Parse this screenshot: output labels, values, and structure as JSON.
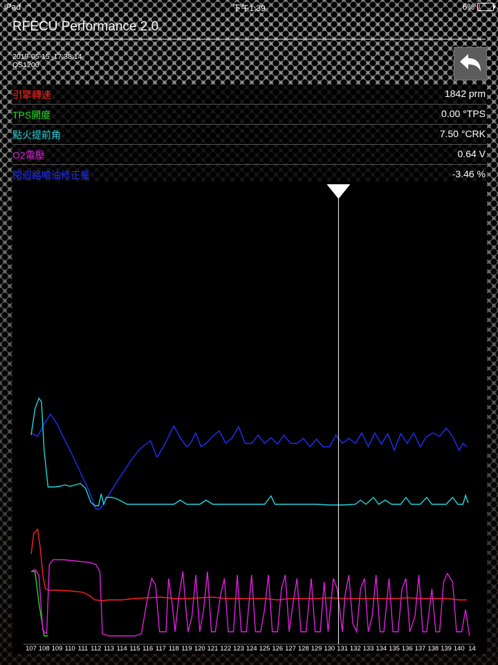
{
  "status_bar": {
    "device": "iPad",
    "time": "下午1:39",
    "battery": "6%"
  },
  "header": {
    "title": "RFECU Performance 2.0",
    "timestamp": "2019-05-15_17:38:14",
    "model": "QS1200"
  },
  "readouts": [
    {
      "label": "引擎轉速",
      "value": "1842 prm",
      "color": "#ff2020"
    },
    {
      "label": "TPS開度",
      "value": "0.00 °TPS",
      "color": "#20e020"
    },
    {
      "label": "點火提前角",
      "value": "7.50 °CRK",
      "color": "#20d8e0"
    },
    {
      "label": "O2電壓",
      "value": "0.64 V",
      "color": "#e020e0"
    },
    {
      "label": "閉迴路噴油修正量",
      "value": "-3.46 %",
      "color": "#2030ff"
    }
  ],
  "chart_data": {
    "type": "line",
    "x_ticks": [
      "107",
      "108",
      "109",
      "110",
      "111",
      "112",
      "113",
      "114",
      "115",
      "116",
      "117",
      "118",
      "119",
      "120",
      "121",
      "122",
      "123",
      "124",
      "125",
      "126",
      "127",
      "128",
      "129",
      "130",
      "131",
      "132",
      "133",
      "134",
      "135",
      "136",
      "137",
      "138",
      "139",
      "140",
      "14"
    ],
    "cursor_x": 130.7,
    "series": [
      {
        "name": "閉迴路噴油修正量",
        "color": "#2030ff",
        "points": [
          [
            107,
            625
          ],
          [
            107.5,
            630
          ],
          [
            108,
            612
          ],
          [
            108.5,
            598
          ],
          [
            109,
            612
          ],
          [
            109.5,
            632
          ],
          [
            110,
            650
          ],
          [
            110.5,
            670
          ],
          [
            111,
            690
          ],
          [
            111.5,
            710
          ],
          [
            112,
            735
          ],
          [
            112.3,
            735
          ],
          [
            112.8,
            720
          ],
          [
            113.3,
            705
          ],
          [
            113.8,
            690
          ],
          [
            114.3,
            676
          ],
          [
            114.8,
            662
          ],
          [
            115.3,
            650
          ],
          [
            115.8,
            642
          ],
          [
            116.2,
            636
          ],
          [
            116.7,
            660
          ],
          [
            117.2,
            645
          ],
          [
            117.6,
            630
          ],
          [
            118,
            615
          ],
          [
            118.5,
            632
          ],
          [
            119,
            645
          ],
          [
            119.3,
            640
          ],
          [
            119.7,
            625
          ],
          [
            120.1,
            645
          ],
          [
            120.5,
            640
          ],
          [
            121,
            630
          ],
          [
            121.5,
            622
          ],
          [
            122,
            640
          ],
          [
            122.5,
            632
          ],
          [
            123,
            616
          ],
          [
            123.5,
            640
          ],
          [
            124,
            640
          ],
          [
            124.5,
            628
          ],
          [
            125,
            640
          ],
          [
            125.5,
            632
          ],
          [
            126,
            641
          ],
          [
            126.5,
            628
          ],
          [
            127,
            640
          ],
          [
            127.5,
            640
          ],
          [
            128,
            633
          ],
          [
            128.5,
            645
          ],
          [
            129,
            634
          ],
          [
            129.5,
            645
          ],
          [
            130,
            645
          ],
          [
            130.5,
            628
          ],
          [
            131,
            640
          ],
          [
            131.5,
            633
          ],
          [
            132,
            640
          ],
          [
            132.5,
            625
          ],
          [
            133,
            645
          ],
          [
            133.5,
            625
          ],
          [
            134,
            641
          ],
          [
            134.5,
            626
          ],
          [
            135,
            650
          ],
          [
            135.5,
            626
          ],
          [
            136,
            640
          ],
          [
            136.5,
            625
          ],
          [
            137,
            645
          ],
          [
            137.5,
            630
          ],
          [
            138,
            625
          ],
          [
            138.5,
            630
          ],
          [
            139,
            618
          ],
          [
            139.5,
            630
          ],
          [
            140,
            650
          ],
          [
            140.3,
            640
          ],
          [
            140.6,
            645
          ]
        ]
      },
      {
        "name": "點火提前角",
        "color": "#20d8e0",
        "points": [
          [
            107,
            628
          ],
          [
            107.3,
            590
          ],
          [
            107.6,
            575
          ],
          [
            107.8,
            580
          ],
          [
            108,
            650
          ],
          [
            108.3,
            703
          ],
          [
            108.8,
            703
          ],
          [
            109.2,
            702
          ],
          [
            109.6,
            700
          ],
          [
            110,
            702
          ],
          [
            110.4,
            700
          ],
          [
            110.8,
            698
          ],
          [
            111.2,
            705
          ],
          [
            111.6,
            725
          ],
          [
            111.9,
            730
          ],
          [
            112.2,
            730
          ],
          [
            112.4,
            713
          ],
          [
            112.6,
            728
          ],
          [
            112.8,
            718
          ],
          [
            113.2,
            718
          ],
          [
            113.6,
            720
          ],
          [
            114,
            724
          ],
          [
            114.4,
            728
          ],
          [
            115,
            728
          ],
          [
            116,
            728
          ],
          [
            117,
            728
          ],
          [
            118,
            728
          ],
          [
            118.5,
            722
          ],
          [
            119,
            728
          ],
          [
            120,
            728
          ],
          [
            120.5,
            722
          ],
          [
            121,
            728
          ],
          [
            122,
            728
          ],
          [
            123,
            728
          ],
          [
            124,
            728
          ],
          [
            125,
            728
          ],
          [
            125.5,
            716
          ],
          [
            125.8,
            728
          ],
          [
            127,
            728
          ],
          [
            128,
            728
          ],
          [
            129,
            728
          ],
          [
            130,
            729
          ],
          [
            131,
            729
          ],
          [
            132,
            728
          ],
          [
            132.4,
            722
          ],
          [
            132.8,
            728
          ],
          [
            133.4,
            718
          ],
          [
            133.8,
            728
          ],
          [
            134.3,
            722
          ],
          [
            134.8,
            728
          ],
          [
            135.5,
            728
          ],
          [
            135.9,
            718
          ],
          [
            136.3,
            728
          ],
          [
            137,
            728
          ],
          [
            137.5,
            718
          ],
          [
            137.9,
            728
          ],
          [
            138.5,
            728
          ],
          [
            139,
            728
          ],
          [
            139.5,
            718
          ],
          [
            139.9,
            728
          ],
          [
            140.3,
            728
          ],
          [
            140.5,
            715
          ],
          [
            140.7,
            726
          ]
        ]
      },
      {
        "name": "引擎轉速",
        "color": "#ff2020",
        "points": [
          [
            107,
            800
          ],
          [
            107.2,
            770
          ],
          [
            107.5,
            764
          ],
          [
            107.7,
            790
          ],
          [
            107.9,
            830
          ],
          [
            108.1,
            850
          ],
          [
            108.4,
            852
          ],
          [
            109,
            852
          ],
          [
            110,
            853
          ],
          [
            111,
            855
          ],
          [
            111.5,
            860
          ],
          [
            111.9,
            866
          ],
          [
            112.5,
            867
          ],
          [
            113,
            866
          ],
          [
            114,
            866
          ],
          [
            115,
            864
          ],
          [
            116,
            863
          ],
          [
            117,
            862
          ],
          [
            118,
            864
          ],
          [
            119,
            864
          ],
          [
            120,
            863
          ],
          [
            121,
            862
          ],
          [
            122,
            864
          ],
          [
            123,
            864
          ],
          [
            124,
            864
          ],
          [
            125,
            864
          ],
          [
            126,
            866
          ],
          [
            127,
            864
          ],
          [
            128,
            864
          ],
          [
            129,
            864
          ],
          [
            130,
            863
          ],
          [
            131,
            864
          ],
          [
            132,
            864
          ],
          [
            133,
            864
          ],
          [
            134,
            864
          ],
          [
            135,
            864
          ],
          [
            136,
            863
          ],
          [
            137,
            864
          ],
          [
            138,
            864
          ],
          [
            139,
            864
          ],
          [
            140,
            866
          ],
          [
            140.6,
            866
          ]
        ]
      },
      {
        "name": "TPS開度",
        "color": "#20e020",
        "points": [
          [
            107,
            825
          ],
          [
            107.3,
            825
          ],
          [
            107.6,
            870
          ],
          [
            108,
            918
          ],
          [
            108.3,
            918
          ]
        ]
      },
      {
        "name": "O2電壓",
        "color": "#e020e0",
        "points": [
          [
            107,
            825
          ],
          [
            107.3,
            822
          ],
          [
            107.6,
            830
          ],
          [
            107.9,
            910
          ],
          [
            108.2,
            915
          ],
          [
            108.4,
            815
          ],
          [
            108.7,
            808
          ],
          [
            109.5,
            808
          ],
          [
            110.5,
            810
          ],
          [
            111.5,
            812
          ],
          [
            112,
            815
          ],
          [
            112.3,
            825
          ],
          [
            112.5,
            915
          ],
          [
            113,
            918
          ],
          [
            114,
            918
          ],
          [
            115,
            918
          ],
          [
            115.5,
            915
          ],
          [
            116,
            860
          ],
          [
            116.3,
            835
          ],
          [
            116.6,
            845
          ],
          [
            116.9,
            912
          ],
          [
            117.4,
            912
          ],
          [
            117.6,
            835
          ],
          [
            117.9,
            875
          ],
          [
            118.1,
            912
          ],
          [
            118.4,
            860
          ],
          [
            118.7,
            825
          ],
          [
            118.9,
            870
          ],
          [
            119.1,
            912
          ],
          [
            119.4,
            890
          ],
          [
            119.7,
            830
          ],
          [
            120,
            912
          ],
          [
            120.3,
            880
          ],
          [
            120.6,
            825
          ],
          [
            120.9,
            912
          ],
          [
            121.2,
            912
          ],
          [
            121.6,
            860
          ],
          [
            121.9,
            835
          ],
          [
            122.2,
            912
          ],
          [
            122.6,
            912
          ],
          [
            122.9,
            830
          ],
          [
            123.2,
            912
          ],
          [
            123.6,
            912
          ],
          [
            124,
            830
          ],
          [
            124.3,
            912
          ],
          [
            124.7,
            912
          ],
          [
            125,
            880
          ],
          [
            125.3,
            830
          ],
          [
            125.6,
            912
          ],
          [
            126,
            912
          ],
          [
            126.3,
            850
          ],
          [
            126.6,
            830
          ],
          [
            126.9,
            912
          ],
          [
            127.2,
            870
          ],
          [
            127.5,
            835
          ],
          [
            127.8,
            912
          ],
          [
            128.2,
            912
          ],
          [
            128.6,
            835
          ],
          [
            128.9,
            912
          ],
          [
            129.3,
            912
          ],
          [
            129.6,
            840
          ],
          [
            129.9,
            912
          ],
          [
            130.3,
            835
          ],
          [
            130.6,
            850
          ],
          [
            131,
            912
          ],
          [
            131.2,
            860
          ],
          [
            131.5,
            830
          ],
          [
            131.8,
            900
          ],
          [
            132.1,
            912
          ],
          [
            132.4,
            850
          ],
          [
            132.7,
            835
          ],
          [
            133,
            912
          ],
          [
            133.3,
            890
          ],
          [
            133.6,
            830
          ],
          [
            133.9,
            912
          ],
          [
            134.2,
            912
          ],
          [
            134.6,
            835
          ],
          [
            134.9,
            912
          ],
          [
            135.3,
            912
          ],
          [
            135.6,
            850
          ],
          [
            135.9,
            835
          ],
          [
            136.2,
            912
          ],
          [
            136.6,
            890
          ],
          [
            136.9,
            830
          ],
          [
            137.2,
            912
          ],
          [
            137.5,
            912
          ],
          [
            137.9,
            850
          ],
          [
            138.2,
            912
          ],
          [
            138.5,
            912
          ],
          [
            138.8,
            840
          ],
          [
            139.1,
            828
          ],
          [
            139.5,
            840
          ],
          [
            139.8,
            912
          ],
          [
            140.2,
            912
          ],
          [
            140.5,
            880
          ],
          [
            140.8,
            918
          ]
        ]
      }
    ]
  }
}
